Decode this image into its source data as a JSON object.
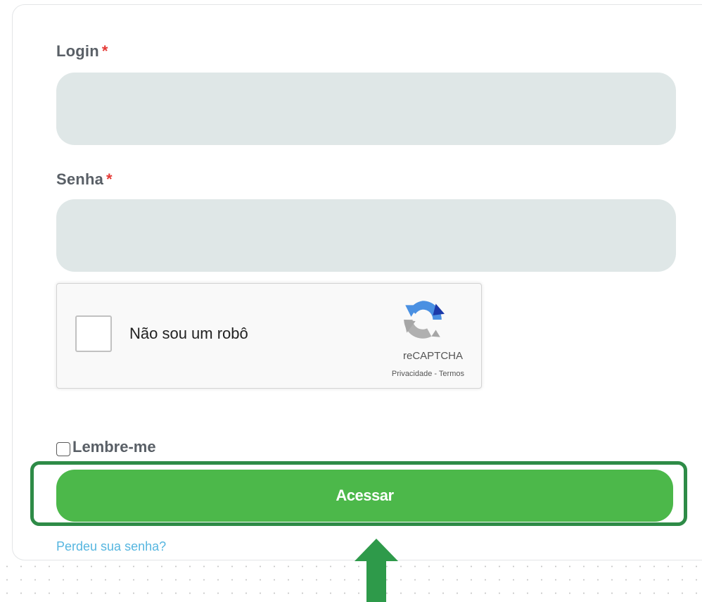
{
  "form": {
    "login": {
      "label": "Login",
      "required_mark": "*",
      "value": "",
      "placeholder": ""
    },
    "password": {
      "label": "Senha",
      "required_mark": "*",
      "value": "",
      "placeholder": ""
    },
    "recaptcha": {
      "label": "Não sou um robô",
      "brand": "reCAPTCHA",
      "links": "Privacidade - Termos",
      "checked": false,
      "icon": "recaptcha-logo-icon"
    },
    "remember": {
      "label": "Lembre-me",
      "checked": false
    },
    "submit_label": "Acessar",
    "lost_password": "Perdeu sua senha?"
  },
  "annotation": {
    "highlight_color": "#2e8b47",
    "arrow_color": "#2e9a4a",
    "arrow_icon": "arrow-up-icon"
  },
  "colors": {
    "button": "#4cb84a",
    "input_bg": "#dfe7e7",
    "label": "#595f66",
    "required": "#e53935",
    "link": "#56b6e0"
  }
}
